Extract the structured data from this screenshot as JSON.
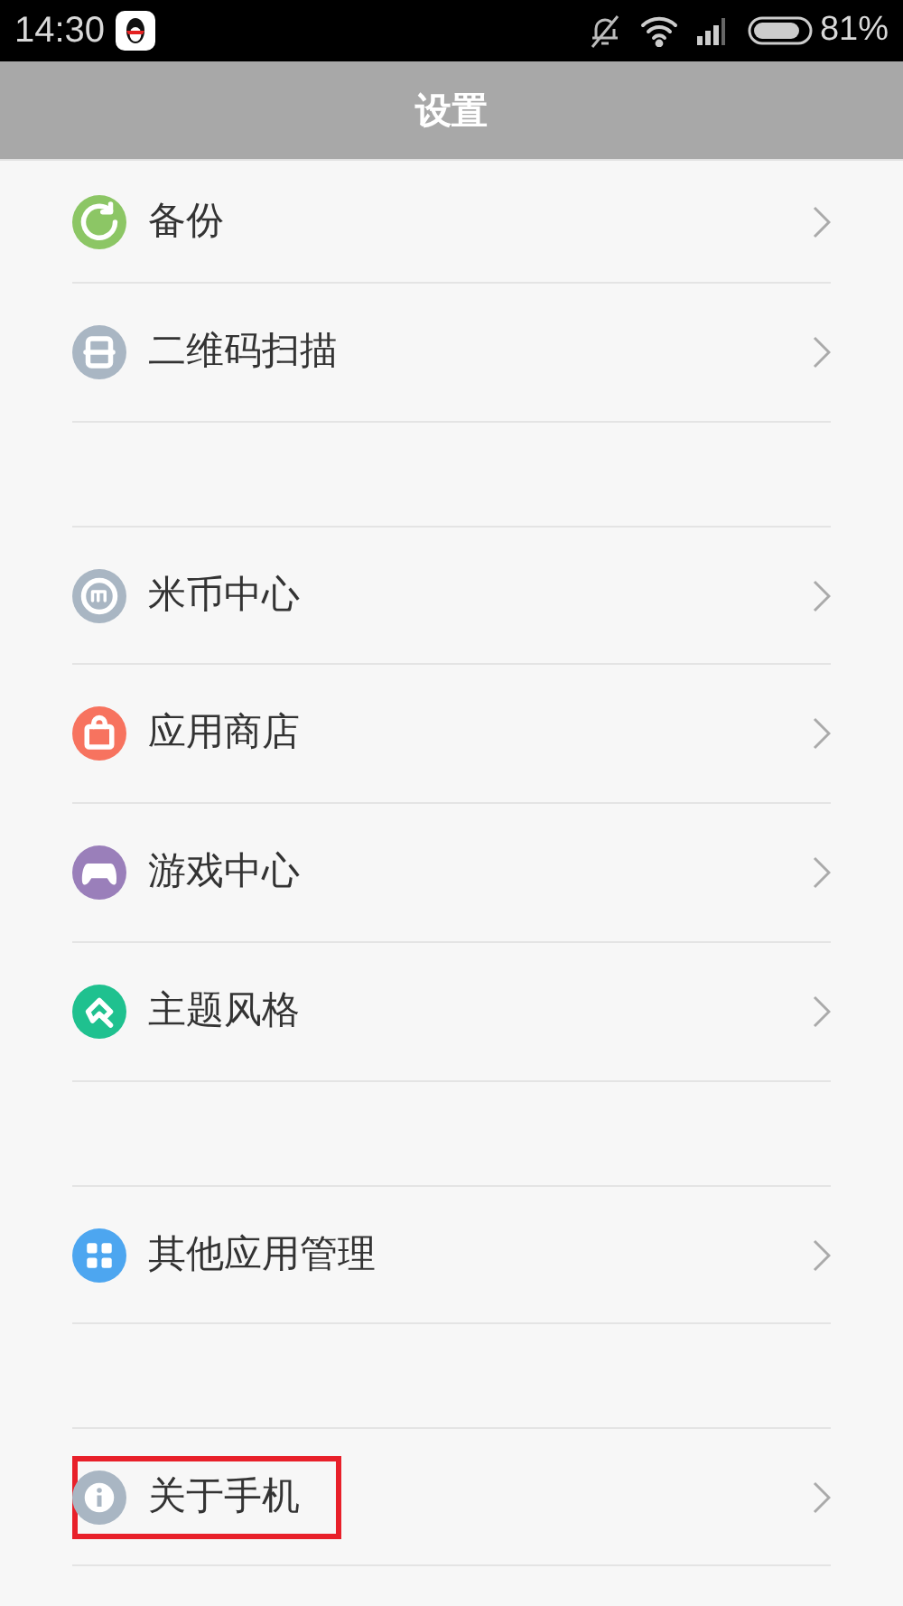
{
  "status_bar": {
    "time": "14:30",
    "battery": "81%"
  },
  "header": {
    "title": "设置"
  },
  "groups": [
    {
      "items": [
        {
          "kind": "backup",
          "label": "备份",
          "color": "#8cc665",
          "highlighted": false
        },
        {
          "kind": "scan",
          "label": "二维码扫描",
          "color": "#a9b6c3",
          "highlighted": false
        }
      ]
    },
    {
      "items": [
        {
          "kind": "coin",
          "label": "米币中心",
          "color": "#a9b6c3",
          "highlighted": false
        },
        {
          "kind": "store",
          "label": "应用商店",
          "color": "#f7735f",
          "highlighted": false
        },
        {
          "kind": "game",
          "label": "游戏中心",
          "color": "#9a7fba",
          "highlighted": false
        },
        {
          "kind": "theme",
          "label": "主题风格",
          "color": "#1fc18f",
          "highlighted": false
        }
      ]
    },
    {
      "items": [
        {
          "kind": "apps",
          "label": "其他应用管理",
          "color": "#4da6f0",
          "highlighted": false
        }
      ]
    },
    {
      "items": [
        {
          "kind": "info",
          "label": "关于手机",
          "color": "#a9b6c3",
          "highlighted": true
        }
      ]
    }
  ]
}
